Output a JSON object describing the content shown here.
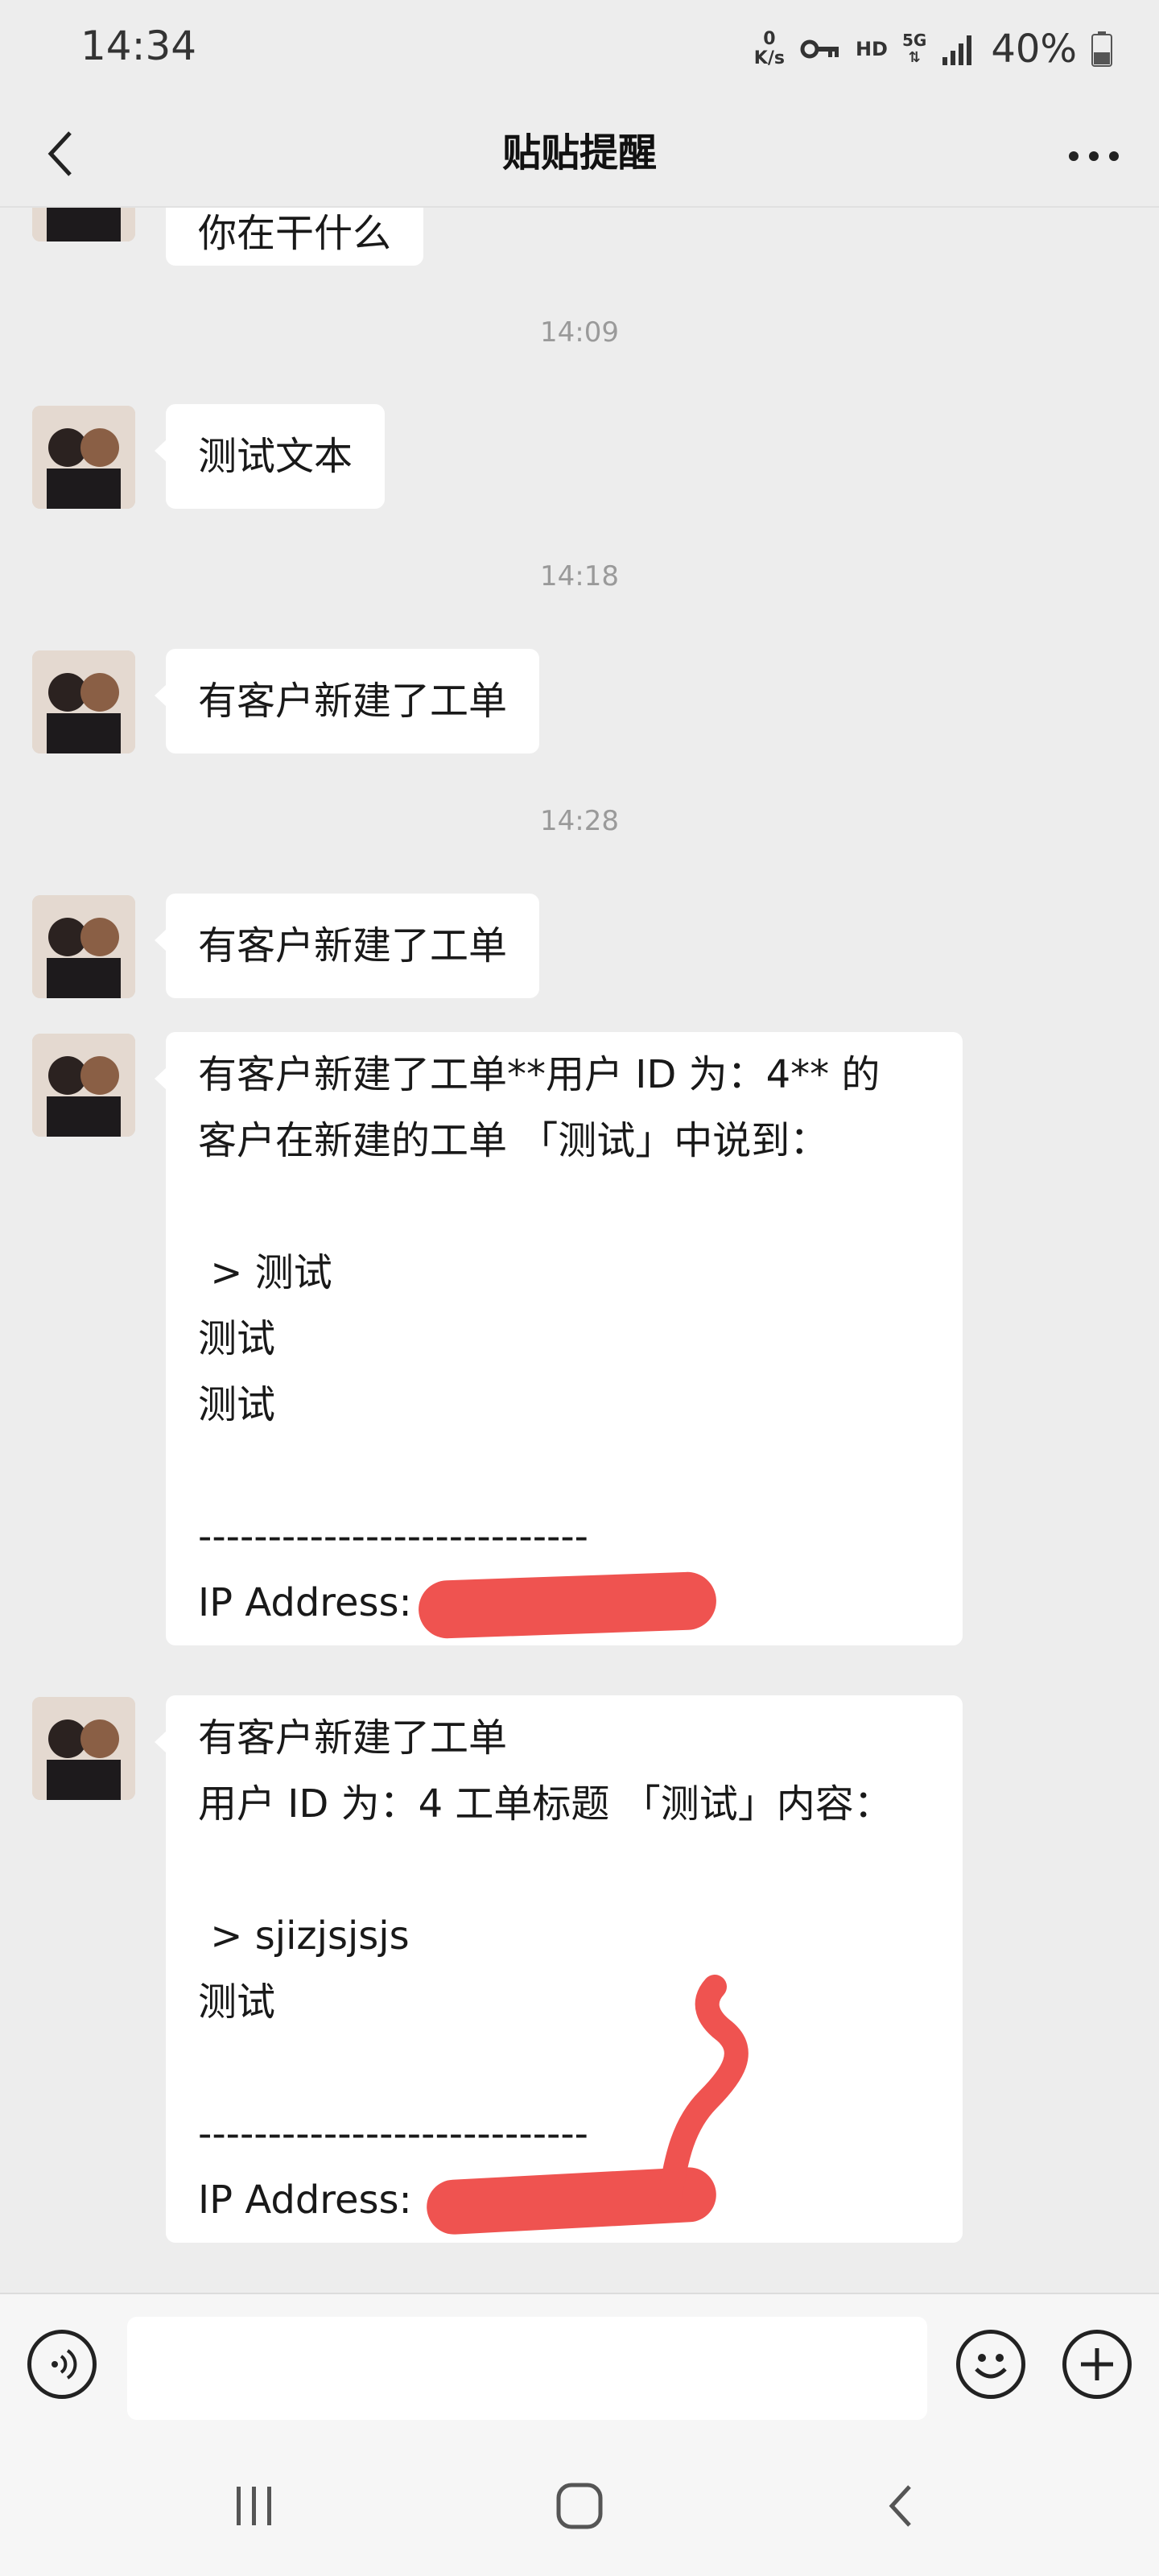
{
  "status_bar": {
    "time": "14:34",
    "net_speed_value": "0",
    "net_speed_unit": "K/s",
    "hd": "HD",
    "network": "5G",
    "battery": "40%",
    "icons": [
      "vpn-key-icon",
      "signal-icon",
      "battery-icon"
    ]
  },
  "header": {
    "title": "贴贴提醒",
    "back_icon": "chevron-left-icon",
    "more_icon": "more-icon"
  },
  "chat": {
    "messages": [
      {
        "type": "text",
        "lines": [
          "你在干什么"
        ]
      },
      {
        "type": "timestamp",
        "text": "14:09"
      },
      {
        "type": "text",
        "lines": [
          "测试文本"
        ]
      },
      {
        "type": "timestamp",
        "text": "14:18"
      },
      {
        "type": "text",
        "lines": [
          "有客户新建了工单"
        ]
      },
      {
        "type": "timestamp",
        "text": "14:28"
      },
      {
        "type": "text",
        "lines": [
          "有客户新建了工单"
        ]
      },
      {
        "type": "text",
        "lines": [
          "有客户新建了工单**用户 ID 为：4** 的",
          "客户在新建的工单 「测试」中说到：",
          "",
          " > 测试",
          "测试",
          "测试",
          "",
          "----------------------------",
          "IP Address: 6"
        ]
      },
      {
        "type": "text",
        "lines": [
          "有客户新建了工单",
          "用户 ID 为：4 工单标题 「测试」内容：",
          "",
          " > sjizjsjsjs",
          "测试",
          "",
          "----------------------------",
          "IP Address:              217"
        ]
      }
    ]
  },
  "input_bar": {
    "value": "",
    "voice_icon": "voice-icon",
    "emoji_icon": "emoji-icon",
    "plus_icon": "plus-icon"
  },
  "nav_bar": {
    "icons": [
      "recent-apps-icon",
      "home-icon",
      "back-icon"
    ]
  },
  "colors": {
    "background": "#ededed",
    "bubble": "#ffffff",
    "redaction": "#ef5350",
    "timestamp": "#9a9a9a"
  }
}
